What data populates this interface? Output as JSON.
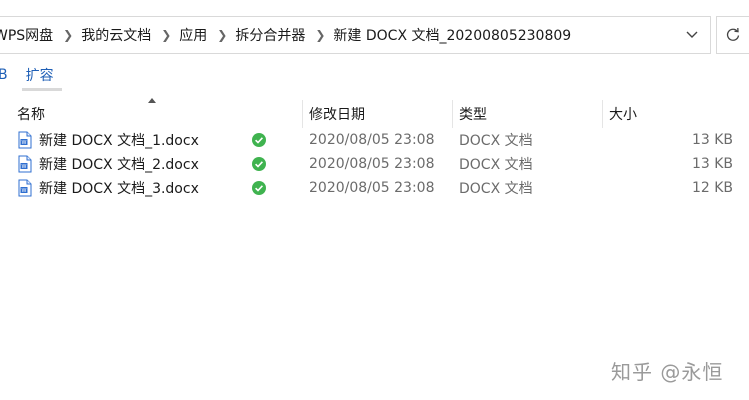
{
  "breadcrumbs": [
    {
      "label": "WPS网盘"
    },
    {
      "label": "我的云文档"
    },
    {
      "label": "应用"
    },
    {
      "label": "拆分合并器"
    },
    {
      "label": "新建 DOCX 文档_20200805230809"
    }
  ],
  "toolbar": {
    "cut_label": "B",
    "expand_label": "扩容"
  },
  "columns": {
    "name": "名称",
    "date": "修改日期",
    "type": "类型",
    "size": "大小"
  },
  "files": [
    {
      "name": "新建 DOCX 文档_1.docx",
      "date": "2020/08/05 23:08",
      "type": "DOCX 文档",
      "size": "13 KB"
    },
    {
      "name": "新建 DOCX 文档_2.docx",
      "date": "2020/08/05 23:08",
      "type": "DOCX 文档",
      "size": "13 KB"
    },
    {
      "name": "新建 DOCX 文档_3.docx",
      "date": "2020/08/05 23:08",
      "type": "DOCX 文档",
      "size": "12 KB"
    }
  ],
  "status": {
    "synced_color": "#3fb34f"
  },
  "accent_color": "#1f5fb6",
  "watermark": "知乎 @永恒",
  "icons": {
    "separator": "chevron-right-icon",
    "dropdown": "chevron-down-icon",
    "refresh": "refresh-icon",
    "file": "word-doc-icon",
    "status": "sync-check-icon"
  }
}
